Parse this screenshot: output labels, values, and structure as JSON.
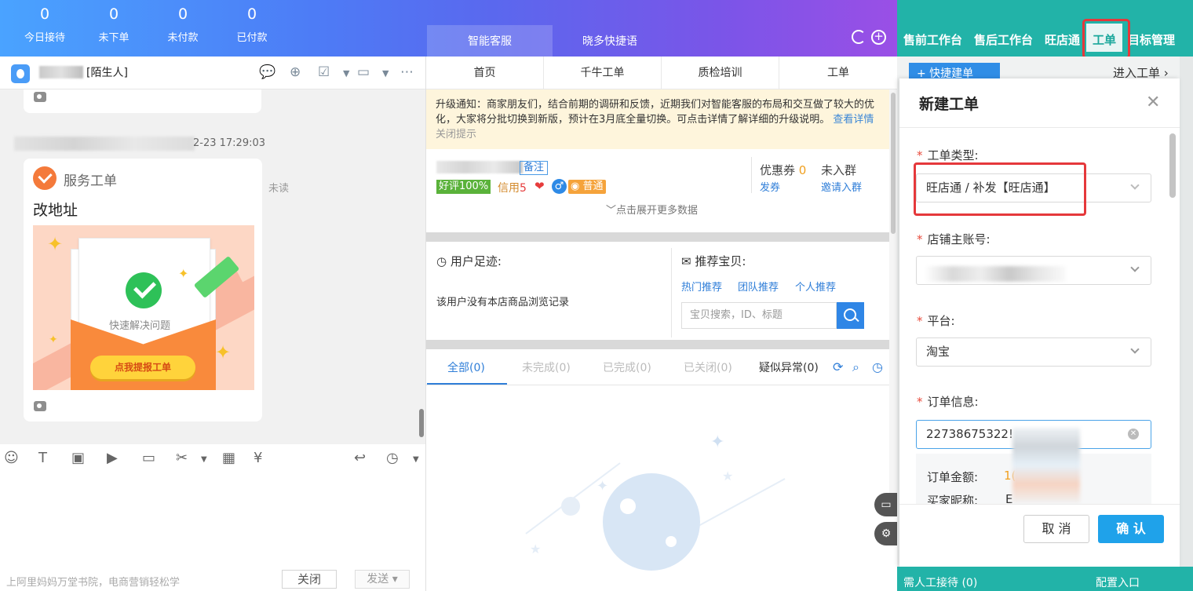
{
  "stats": [
    {
      "num": "0",
      "label": "今日接待"
    },
    {
      "num": "0",
      "label": "未下单"
    },
    {
      "num": "0",
      "label": "未付款"
    },
    {
      "num": "0",
      "label": "已付款"
    }
  ],
  "top_tabs": {
    "smart": "智能客服",
    "xiaoduo": "晓多快捷语"
  },
  "chat": {
    "contact_tag": "[陌生人]",
    "timestamp": "2-23 17:29:03",
    "card_title": "服务工单",
    "message": "改地址",
    "unread": "未读",
    "banner_text": "快速解决问题",
    "banner_button": "点我提报工单",
    "footer_text": "上阿里妈妈万堂书院，电商营销轻松学",
    "close_label": "关闭",
    "send_label": "发送"
  },
  "mid_nav": [
    "首页",
    "千牛工单",
    "质检培训",
    "工单"
  ],
  "notice": {
    "text": "升级通知：商家朋友们，结合前期的调研和反馈，近期我们对智能客服的布局和交互做了较大的优化，大家将分批切换到新版，预计在3月底全量切换。可点击详情了解详细的升级说明。",
    "detail_link": "查看详情",
    "close_link": "关闭提示"
  },
  "customer": {
    "note_label": "备注",
    "good_rate": "好评100%",
    "credit_label": "信用",
    "credit_value": "5",
    "member_level": "普通",
    "expand_label": "点击展开更多数据",
    "coupon_title": "优惠券",
    "coupon_count": "0",
    "coupon_link": "发券",
    "group_title": "未入群",
    "group_link": "邀请入群"
  },
  "footprint": {
    "title": "用户足迹:",
    "empty": "该用户没有本店商品浏览记录"
  },
  "recommend": {
    "title": "推荐宝贝:",
    "links": [
      "热门推荐",
      "团队推荐",
      "个人推荐"
    ],
    "search_placeholder": "宝贝搜索，ID、标题"
  },
  "order_tabs": [
    "全部(0)",
    "未完成(0)",
    "已完成(0)",
    "已关闭(0)",
    "疑似异常(0)"
  ],
  "right_tabs": [
    "售前工作台",
    "售后工作台",
    "旺店通",
    "工单",
    "目标管理"
  ],
  "right_panel": {
    "quick_create": "+ 快捷建单",
    "enter_order": "进入工单 ›",
    "modal_title": "新建工单",
    "fields": {
      "type_label": "工单类型:",
      "type_value": "旺店通 / 补发【旺店通】",
      "account_label": "店铺主账号:",
      "platform_label": "平台:",
      "platform_value": "淘宝",
      "order_label": "订单信息:",
      "order_value": "22738675322!"
    },
    "amount_label": "订单金额:",
    "amount_value": "1(",
    "nick_label": "买家昵称:",
    "nick_value": "E",
    "cancel": "取 消",
    "confirm": "确 认",
    "need_human": "需人工接待 (0)",
    "config_entry": "配置入口"
  },
  "colors": {
    "accent": "#2f7ed8",
    "teal": "#22b3a8",
    "highlight_red": "#e5383b",
    "confirm_blue": "#1fa2ea"
  }
}
